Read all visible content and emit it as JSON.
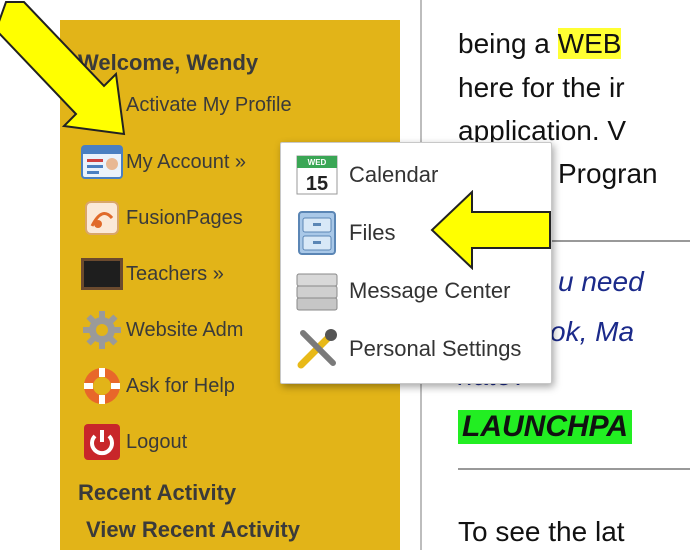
{
  "sidebar": {
    "welcome": "Welcome, Wendy",
    "items": [
      {
        "label": "Activate My Profile",
        "icon": "profile-check-icon"
      },
      {
        "label": "My Account »",
        "icon": "account-card-icon"
      },
      {
        "label": "FusionPages",
        "icon": "fusionpages-icon"
      },
      {
        "label": "Teachers »",
        "icon": "blackboard-icon"
      },
      {
        "label": "Website Adm",
        "icon": "gear-icon"
      },
      {
        "label": "Ask for Help",
        "icon": "lifebuoy-icon"
      },
      {
        "label": "Logout",
        "icon": "power-icon"
      }
    ],
    "recent_activity_title": "Recent Activity",
    "view_recent_activity": "View Recent Activity"
  },
  "dropdown": {
    "items": [
      {
        "label": "Calendar",
        "icon": "calendar-icon",
        "date_text": "15",
        "day_text": "WED"
      },
      {
        "label": "Files",
        "icon": "file-cabinet-icon"
      },
      {
        "label": "Message Center",
        "icon": "inbox-tray-icon"
      },
      {
        "label": "Personal Settings",
        "icon": "tools-icon"
      }
    ]
  },
  "main": {
    "line1_prefix": "being a ",
    "line1_highlight": "WEB",
    "line2": "here for the ir",
    "line3": "application.  V",
    "line4": "Progran",
    "italic1": "u need",
    "italic2": "ok, Ma",
    "italic3": "nate?",
    "launch": "LAUNCHPA",
    "bottom": "To see the lat"
  },
  "colors": {
    "sidebar_bg": "#e2b418",
    "arrow_fill": "#ffff00",
    "highlight_yellow": "#ffff33",
    "highlight_green": "#22ee22",
    "italic_text": "#1b2a8a"
  }
}
